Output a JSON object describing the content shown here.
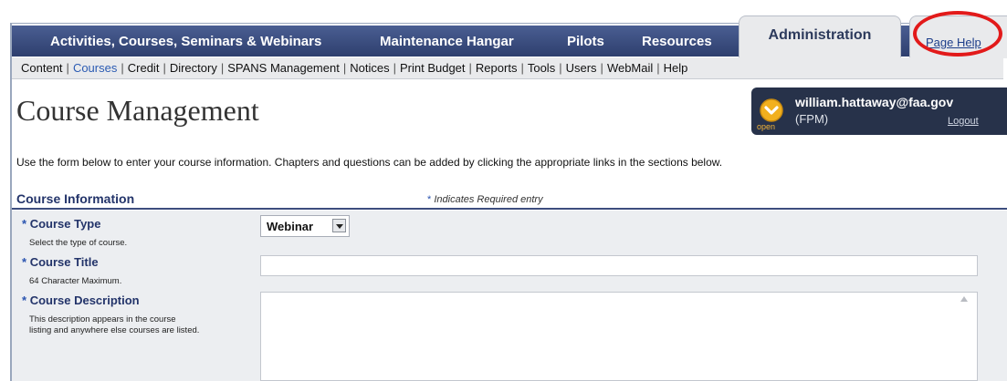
{
  "nav": {
    "items": [
      {
        "label": "Activities, Courses, Seminars & Webinars"
      },
      {
        "label": "Maintenance Hangar"
      },
      {
        "label": "Pilots"
      },
      {
        "label": "Resources"
      }
    ],
    "active_label": "Administration",
    "page_help": "Page Help"
  },
  "subnav": {
    "items": [
      "Content",
      "Courses",
      "Credit",
      "Directory",
      "SPANS Management",
      "Notices",
      "Print Budget",
      "Reports",
      "Tools",
      "Users",
      "WebMail",
      "Help"
    ],
    "active": "Courses",
    "separator": "|"
  },
  "page_title": "Course Management",
  "user": {
    "email": "william.hattaway@faa.gov",
    "role": "(FPM)",
    "logout": "Logout",
    "status": "open",
    "icon": "chevron-down-circle-icon"
  },
  "instructions": "Use the form below to enter your course information. Chapters and questions can be added by clicking the appropriate links in the sections below.",
  "section": {
    "title": "Course Information",
    "required_star": "*",
    "required_note": "Indicates Required entry"
  },
  "form": {
    "course_type": {
      "label": "Course Type",
      "hint": "Select the type of course.",
      "value": "Webinar"
    },
    "course_title": {
      "label": "Course Title",
      "hint": "64 Character Maximum.",
      "value": ""
    },
    "course_description": {
      "label": "Course Description",
      "hint_line1": "This description appears in the course",
      "hint_line2": "listing and anywhere else courses are listed.",
      "value": ""
    }
  },
  "colors": {
    "nav_bg": "#3a4c80",
    "accent_red": "#e21a1a",
    "link_blue": "#2b5bb3",
    "label_navy": "#23346a"
  }
}
